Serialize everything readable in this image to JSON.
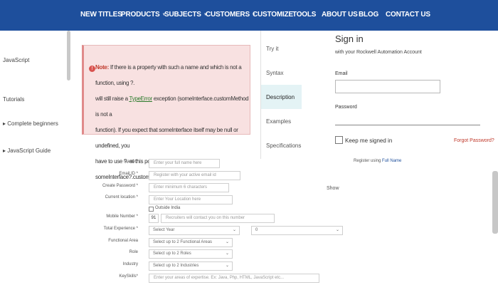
{
  "nav": {
    "items": [
      {
        "label": "NEW TITLES",
        "dropdown": false
      },
      {
        "label": "PRODUCTS",
        "dropdown": true
      },
      {
        "label": "SUBJECTS",
        "dropdown": true
      },
      {
        "label": "CUSTOMERS",
        "dropdown": true
      },
      {
        "label": "CUSTOMIZE",
        "dropdown": false
      },
      {
        "label": "TOOLS",
        "dropdown": false
      },
      {
        "label": "ABOUT US",
        "dropdown": false
      },
      {
        "label": "BLOG",
        "dropdown": false
      },
      {
        "label": "CONTACT US",
        "dropdown": false
      }
    ],
    "bg_color": "#1e4f9c"
  },
  "left_sidebar": {
    "links": [
      "JavaScript",
      "Tutorials",
      "Complete beginners",
      "JavaScript Guide"
    ]
  },
  "note": {
    "label": "Note:",
    "line1": "If there is a property with such a name and which is not a function, using ?.",
    "line2a": "will still raise a ",
    "link": "TypeError",
    "line2b": " exception (someInterface.customMethod is not a",
    "line3": "function). If you expect that someInterface itself may be null or undefined, you",
    "line4": "have to use ?. at this position as well: someInterface?.customMethod?.()"
  },
  "tabs": [
    {
      "label": "Try it",
      "active": false
    },
    {
      "label": "Syntax",
      "active": false
    },
    {
      "label": "Description",
      "active": true
    },
    {
      "label": "Examples",
      "active": false
    },
    {
      "label": "Specifications",
      "active": false
    }
  ],
  "signin": {
    "title": "Sign in",
    "subtitle": "with your Rockwell Automation Account",
    "email_label": "Email",
    "password_label": "Password",
    "keep_signed_in": "Keep me signed in",
    "forgot": "Forgot Password?"
  },
  "registration": {
    "name_label": "Name *",
    "name_placeholder": "Enter your full name here",
    "email_label": "Email ID *",
    "email_placeholder": "Register with your active email id",
    "password_label": "Create Password *",
    "password_placeholder": "Enter minimum 6 characters",
    "show": "Show",
    "location_label": "Current location *",
    "location_placeholder": "Enter Your Location here",
    "outside_india": "Outside India",
    "mobile_label": "Mobile Number *",
    "mobile_code": "91",
    "mobile_placeholder": "Recruiters will contact you on this number",
    "experience_label": "Total Experience *",
    "experience_year": "Select Year",
    "experience_month": "0",
    "functional_label": "Functional Area",
    "functional_value": "Select up to 2 Functional Areas",
    "role_label": "Role",
    "role_value": "Select up to 2 Roles",
    "industry_label": "Industry",
    "industry_value": "Select up to 2 Industries",
    "keyskills_label": "KeySkills*",
    "keyskills_placeholder": "Enter your areas of expertise. Ex: Java, Php, HTML, JavaScript etc...",
    "register_using_prefix": "Register using ",
    "register_using_link": "Full Name"
  }
}
